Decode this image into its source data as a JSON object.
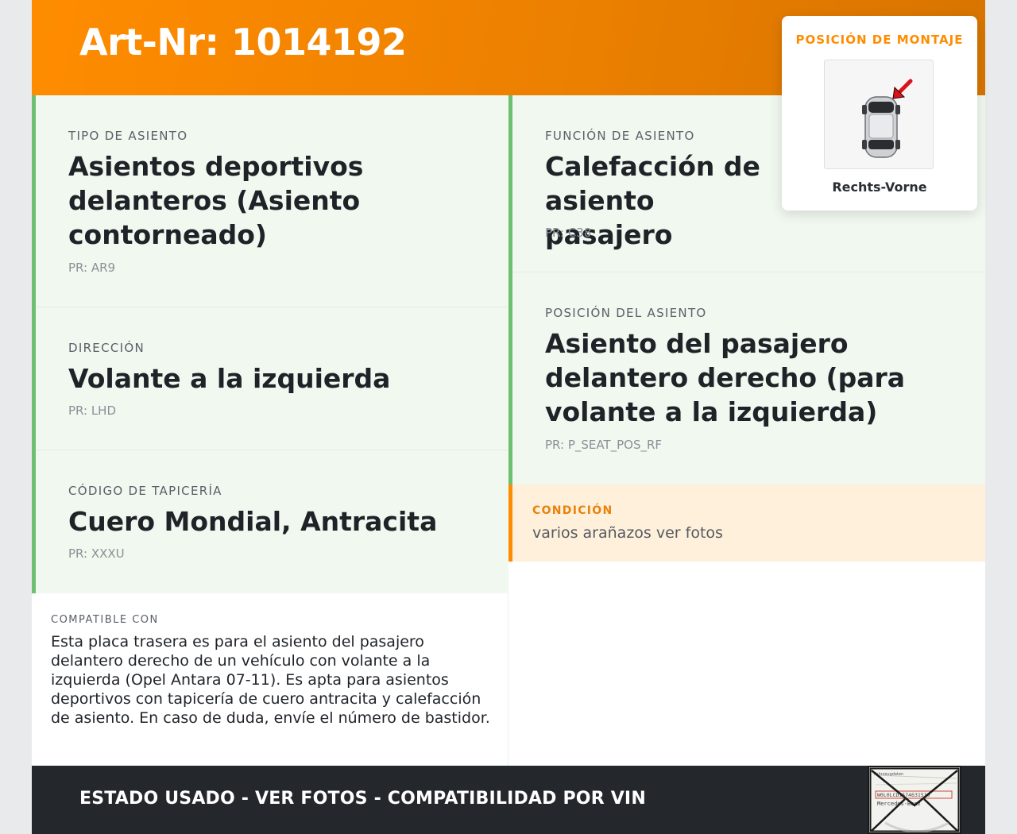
{
  "header": {
    "art_title": "Art-Nr: 1014192"
  },
  "left_column": [
    {
      "label": "TIPO DE ASIENTO",
      "value": "Asientos deportivos delanteros (Asiento contorneado)",
      "pr": "PR: AR9"
    },
    {
      "label": "DIRECCIÓN",
      "value": "Volante a la izquierda",
      "pr": "PR: LHD"
    },
    {
      "label": "CÓDIGO DE TAPICERÍA",
      "value": "Cuero Mondial, Antracita",
      "pr": "PR: XXXU"
    }
  ],
  "right_column": [
    {
      "label": "FUNCIÓN DE ASIENTO",
      "value": "Calefacción de asiento pasajero",
      "pr": "PR: C38"
    },
    {
      "label": "POSICIÓN DEL ASIENTO",
      "value": "Asiento del pasajero delantero derecho (para volante a la izquierda)",
      "pr": "PR: P_SEAT_POS_RF"
    }
  ],
  "condition": {
    "label": "CONDICIÓN",
    "text": "varios arañazos ver fotos"
  },
  "compatible": {
    "label": "COMPATIBLE CON",
    "text": "Esta placa trasera es para el asiento del pasajero delantero derecho de un vehículo con volante a la izquierda (Opel Antara 07-11). Es apta para asientos deportivos con tapicería de cuero antracita y calefacción de asiento. En caso de duda, envíe el número de bastidor."
  },
  "mount_card": {
    "title": "POSICIÓN DE MONTAJE",
    "caption": "Rechts-Vorne",
    "icon": "car-top-view-with-arrow"
  },
  "footer": {
    "text": "ESTADO USADO - VER FOTOS - COMPATIBILIDAD POR VIN",
    "vin_card": {
      "text_1": "Fahrzeugdaten",
      "text_2": "W0L0LCD1574631519",
      "text_3": "Mercedes-Benz",
      "icon": "envelope-icon"
    }
  },
  "colors": {
    "accent": "#ff8c00",
    "green_border": "#6cc070",
    "panel_bg": "#f0f8f0",
    "condition_bg": "#fff0dc",
    "footer_bg": "#24272b"
  }
}
